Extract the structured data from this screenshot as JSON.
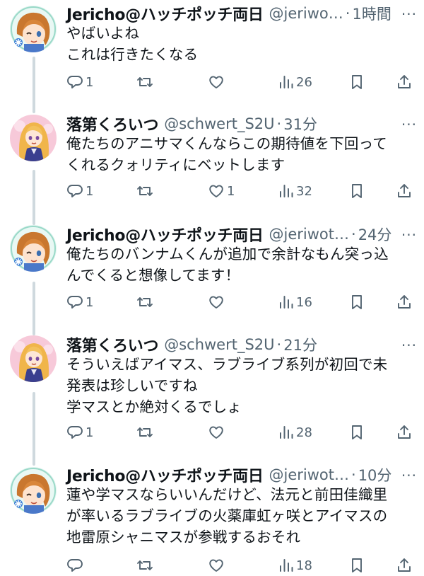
{
  "tweets": [
    {
      "name": "Jericho@ハッチポッチ両日",
      "handle": "@jeriwo…",
      "time": "1時間",
      "lines": [
        "やばいよね",
        "これは行きたくなる"
      ],
      "replies": "1",
      "retweets": "",
      "likes": "",
      "views": "26",
      "avatar": "jericho"
    },
    {
      "name": "落第くろいつ",
      "handle": "@schwert_S2U",
      "time": "31分",
      "lines": [
        "俺たちのアニサマくんならこの期待値を下回って",
        "くれるクォリティにベットします"
      ],
      "replies": "1",
      "retweets": "",
      "likes": "1",
      "views": "32",
      "avatar": "kuroitsu"
    },
    {
      "name": "Jericho@ハッチポッチ両日",
      "handle": "@jeriwot…",
      "time": "24分",
      "lines": [
        "俺たちのバンナムくんが追加で余計なもん突っ込",
        "んでくると想像してます！"
      ],
      "replies": "1",
      "retweets": "",
      "likes": "",
      "views": "16",
      "avatar": "jericho"
    },
    {
      "name": "落第くろいつ",
      "handle": "@schwert_S2U",
      "time": "21分",
      "lines": [
        "そういえばアイマス、ラブライブ系列が初回で未",
        "発表は珍しいですね",
        "学マスとか絶対くるでしょ"
      ],
      "replies": "1",
      "retweets": "",
      "likes": "",
      "views": "28",
      "avatar": "kuroitsu"
    },
    {
      "name": "Jericho@ハッチポッチ両日",
      "handle": "@jeriwot…",
      "time": "10分",
      "lines": [
        "蓮や学マスならいいんだけど、法元と前田佳織里",
        "が率いるラブライブの火薬庫虹ヶ咲とアイマスの",
        "地雷原シャニマスが参戦するおそれ"
      ],
      "replies": "",
      "retweets": "",
      "likes": "",
      "views": "18",
      "avatar": "jericho"
    }
  ],
  "ui": {
    "more_glyph": "···"
  },
  "colors": {
    "text": "#0f1419",
    "muted": "#536471",
    "thread_line": "#cfd9de"
  }
}
